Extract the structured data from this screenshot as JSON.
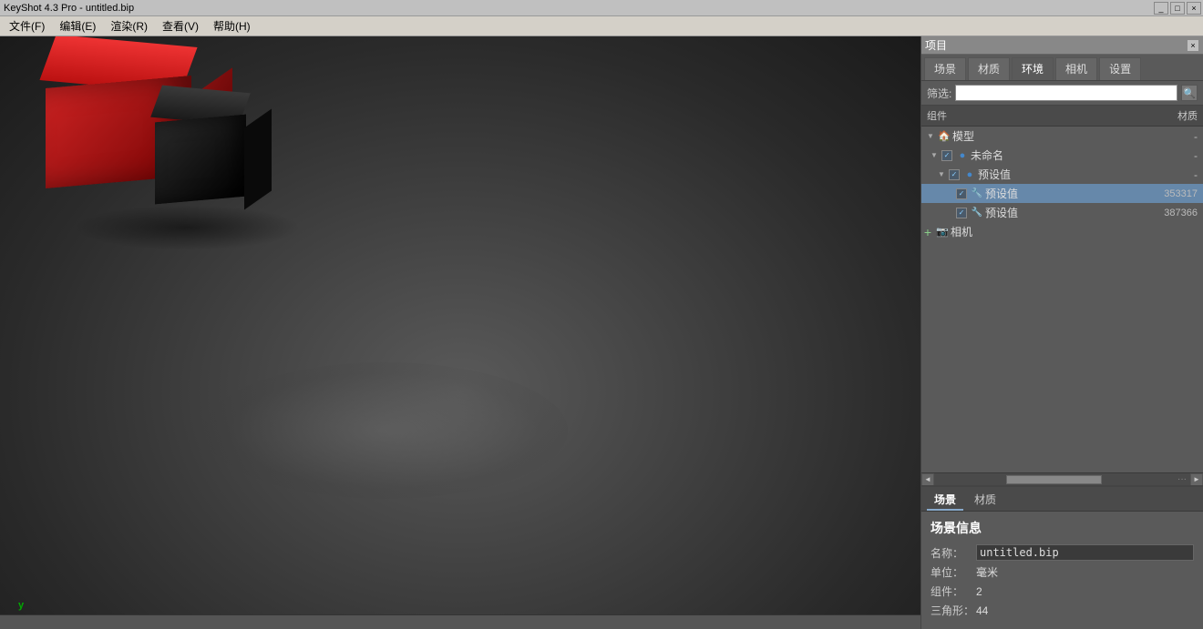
{
  "titleBar": {
    "text": "KeyShot 4.3 Pro  - untitled.bip",
    "controls": [
      "_",
      "□",
      "×"
    ]
  },
  "menuBar": {
    "items": [
      "文件(F)",
      "编辑(E)",
      "渲染(R)",
      "查看(V)",
      "帮助(H)"
    ]
  },
  "viewport": {
    "yAxisLabel": "y"
  },
  "panel": {
    "title": "项目",
    "closeBtn": "×",
    "tabs": [
      {
        "label": "场景",
        "active": false
      },
      {
        "label": "材质",
        "active": false
      },
      {
        "label": "环境",
        "active": true
      },
      {
        "label": "相机",
        "active": false
      },
      {
        "label": "设置",
        "active": false
      }
    ],
    "search": {
      "label": "筛选:",
      "placeholder": ""
    },
    "treeHeader": {
      "components": "组件",
      "material": "材质"
    },
    "treeItems": [
      {
        "indent": 0,
        "hasArrow": true,
        "arrowDir": "down",
        "icon": "🏠",
        "iconColor": "#cc8844",
        "label": "模型",
        "value": "-",
        "checked": false,
        "hasCheckbox": false
      },
      {
        "indent": 1,
        "hasArrow": true,
        "arrowDir": "down",
        "icon": "🔵",
        "iconColor": "#4488cc",
        "label": "未命名",
        "value": "-",
        "checked": true,
        "hasCheckbox": true
      },
      {
        "indent": 2,
        "hasArrow": true,
        "arrowDir": "down",
        "icon": "🔵",
        "iconColor": "#4488cc",
        "label": "预设值",
        "value": "-",
        "checked": true,
        "hasCheckbox": true
      },
      {
        "indent": 3,
        "hasArrow": false,
        "icon": "🔧",
        "iconColor": "#4488cc",
        "label": "预设值",
        "value": "353317",
        "checked": true,
        "hasCheckbox": true,
        "selected": true
      },
      {
        "indent": 3,
        "hasArrow": false,
        "icon": "🔧",
        "iconColor": "#4488cc",
        "label": "预设值",
        "value": "387366",
        "checked": true,
        "hasCheckbox": true
      },
      {
        "indent": 0,
        "hasArrow": false,
        "icon": "📷",
        "iconColor": "#88aacc",
        "label": "相机",
        "value": "",
        "checked": false,
        "hasCheckbox": false,
        "hasAdd": true
      }
    ],
    "bottomTabs": [
      {
        "label": "场景",
        "active": true
      },
      {
        "label": "材质",
        "active": false
      }
    ],
    "sceneInfo": {
      "title": "场景信息",
      "rows": [
        {
          "label": "名称：",
          "value": "untitled.bip",
          "isInput": true
        },
        {
          "label": "单位：",
          "value": "毫米",
          "isInput": false
        },
        {
          "label": "组件：",
          "value": "2",
          "isInput": false
        },
        {
          "label": "三角形：",
          "value": "44",
          "isInput": false
        }
      ]
    }
  }
}
